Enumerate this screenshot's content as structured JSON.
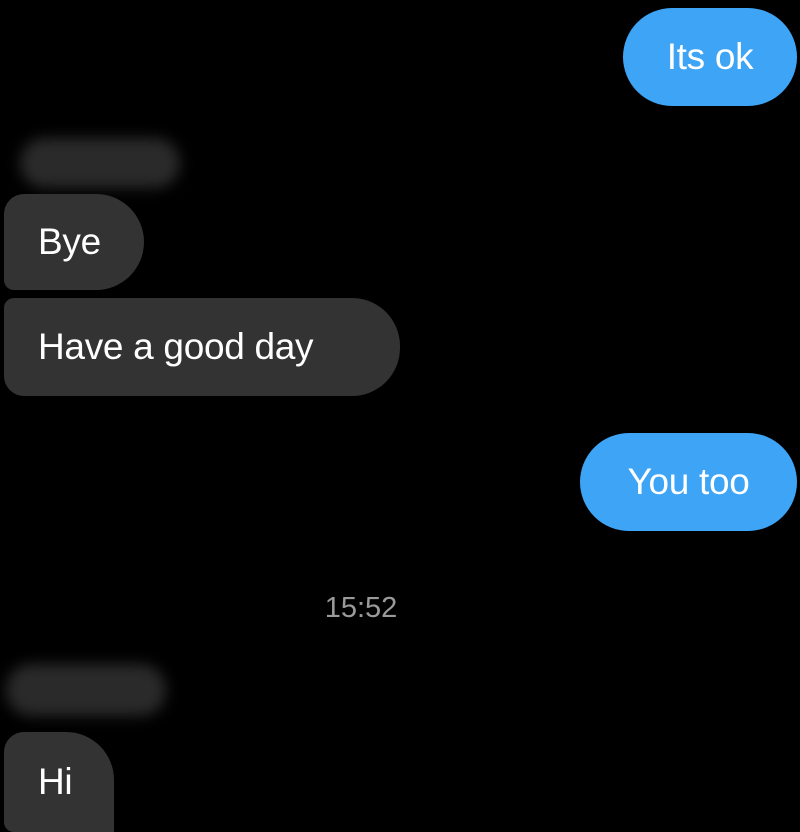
{
  "conversation": {
    "messages": [
      {
        "direction": "outgoing",
        "text": "Its ok"
      },
      {
        "direction": "incoming",
        "text": "Bye"
      },
      {
        "direction": "incoming",
        "text": "Have a good day"
      },
      {
        "direction": "outgoing",
        "text": "You too"
      },
      {
        "direction": "incoming",
        "text": "Hi"
      }
    ],
    "timestamp": "15:52"
  },
  "colors": {
    "background": "#000000",
    "outgoing_bubble": "#3ea4f6",
    "incoming_bubble": "#333333",
    "timestamp_text": "#9a9a9a"
  }
}
